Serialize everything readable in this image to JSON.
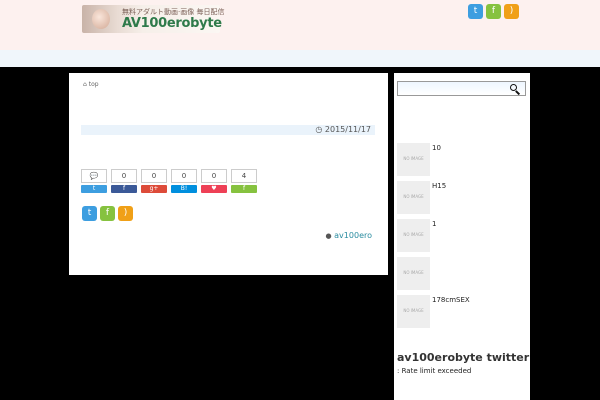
{
  "header": {
    "logo_tagline": "無料アダルト動画·画像 毎日配信",
    "logo_text": "AV100erobyte",
    "social": {
      "twitter": "twitter-icon",
      "feedly": "feedly-icon",
      "rss": "rss-icon"
    }
  },
  "breadcrumb": {
    "label": "top"
  },
  "post": {
    "date": "2015/11/17",
    "author": "av100ero"
  },
  "share": {
    "counts": [
      "",
      "0",
      "0",
      "0",
      "0",
      "4"
    ],
    "buttons": [
      "comments-icon",
      "twitter-icon",
      "facebook-icon",
      "google-plus-icon",
      "hatena-icon",
      "pocket-icon",
      "feedly-icon"
    ]
  },
  "sidebar": {
    "search": {
      "value": "",
      "placeholder": ""
    },
    "thumb_label": "NO IMAGE",
    "posts": [
      "10",
      "H15",
      "1",
      "",
      "178cmSEX"
    ],
    "twitter_widget": {
      "title": "av100erobyte twitter",
      "message": ": Rate limit exceeded"
    }
  },
  "colors": {
    "twitter": "#3d9ee0",
    "feedly": "#86c23f",
    "rss": "#f0a017",
    "facebook": "#3b5998",
    "google_plus": "#dd4b39",
    "hatena": "#008fde",
    "pocket": "#ee4056",
    "link": "#2a8ca0"
  }
}
